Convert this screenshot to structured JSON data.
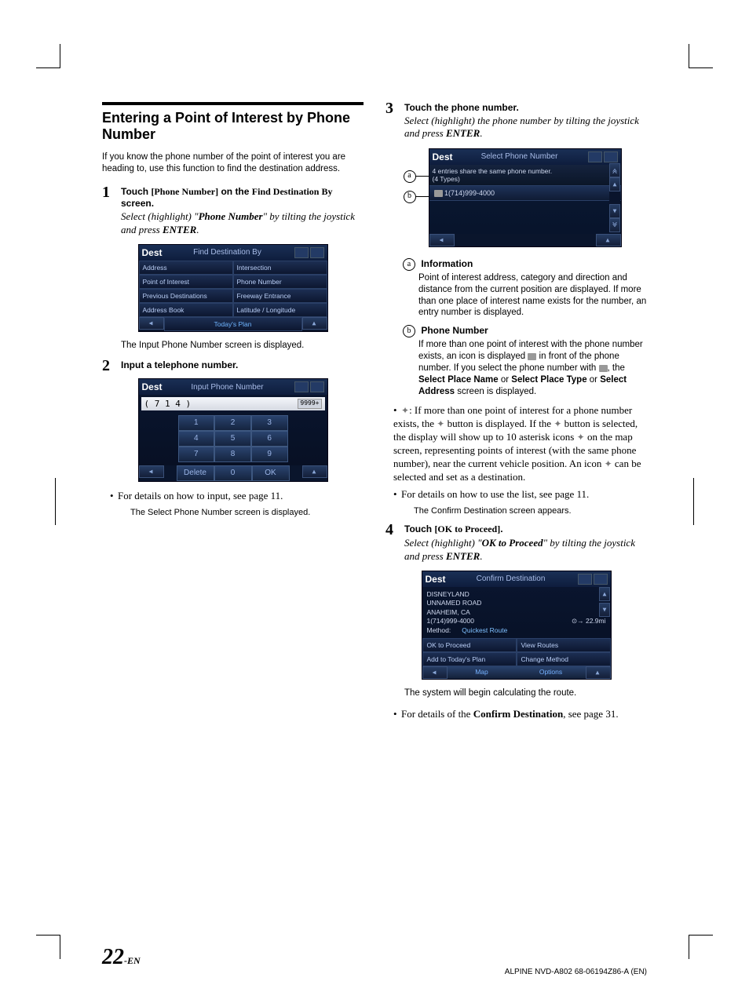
{
  "section": {
    "title": "Entering a Point of Interest by Phone Number",
    "intro": "If you know the phone number of the point of interest you are heading to, use this function to find the destination address."
  },
  "steps": {
    "s1": {
      "num": "1",
      "line1a": "Touch ",
      "line1b": "[Phone Number]",
      "line1c": " on the ",
      "line1d": "Find Destination By",
      "line1e": " screen.",
      "italic1": "Select (highlight) \"",
      "italic2": "Phone Number",
      "italic3": "\" by tilting the joystick and press ",
      "italic4": "ENTER",
      "italic5": ".",
      "after": "The Input Phone Number screen is displayed."
    },
    "s2": {
      "num": "2",
      "title": "Input a telephone number.",
      "bullet": "For details on how to input, see page 11.",
      "after": "The Select Phone Number screen is displayed."
    },
    "s3": {
      "num": "3",
      "title": "Touch the phone number.",
      "italic": "Select (highlight) the phone number by tilting the joystick and press ",
      "italic2": "ENTER",
      "italic3": "."
    },
    "s4": {
      "num": "4",
      "line1a": "Touch ",
      "line1b": "[OK to Proceed]",
      "line1c": ".",
      "italic1": "Select (highlight) \"",
      "italic2": "OK to Proceed",
      "italic3": "\" by tilting the joystick and press ",
      "italic4": "ENTER",
      "italic5": ".",
      "after": "The system will begin calculating the route.",
      "bullet1": "For details of the ",
      "bullet2": "Confirm Destination",
      "bullet3": ", see page 31."
    }
  },
  "callouts": {
    "a": {
      "letter": "a",
      "title": "Information",
      "body": "Point of interest address, category and direction and distance from the current position are displayed. If more than one place of interest name exists for the number, an entry number is displayed."
    },
    "b": {
      "letter": "b",
      "title": "Phone Number",
      "body1": "If more than one point of interest with the phone number exists, an icon is displayed ",
      "body2": " in front of the phone number. If you select the phone number with ",
      "body3": ", the ",
      "body4": "Select Place Name",
      "body5": " or ",
      "body6": "Select Place Type",
      "body7": " or ",
      "body8": "Select Address",
      "body9": " screen is displayed."
    }
  },
  "bullets": {
    "star1": ": If more than one point of interest for a phone number exists, the ",
    "star2": " button is displayed. If the ",
    "star3": " button is selected, the display will show up to 10 asterisk icons ",
    "star4": " on the map screen, representing points of interest (with the same phone number), near the current vehicle position. An icon ",
    "star5": " can be selected and set as a destination.",
    "list": "For details on how to use the list, see page 11.",
    "listAfter": "The Confirm Destination screen appears."
  },
  "screens": {
    "findDest": {
      "dest": "Dest",
      "title": "Find Destination By",
      "cells": [
        "Address",
        "Intersection",
        "Point of Interest",
        "Phone Number",
        "Previous Destinations",
        "Freeway Entrance",
        "Address Book",
        "Latitude / Longitude"
      ],
      "todays": "Today's Plan"
    },
    "inputPhone": {
      "dest": "Dest",
      "title": "Input Phone Number",
      "entry": "( 7 1 4 )",
      "entryR": "9999+",
      "keys": [
        "1",
        "2",
        "3",
        "4",
        "5",
        "6",
        "7",
        "8",
        "9",
        "Delete",
        "0",
        "OK"
      ]
    },
    "selectPhone": {
      "dest": "Dest",
      "title": "Select Phone Number",
      "info1": "4 entries share the same phone number.",
      "info2": "(4 Types)",
      "entry": "1(714)999-4000"
    },
    "confirm": {
      "dest": "Dest",
      "title": "Confirm Destination",
      "poi": "DISNEYLAND",
      "road": "UNNAMED ROAD",
      "city": "ANAHEIM, CA",
      "phone": "1(714)999-4000",
      "methodL": "Method:",
      "methodV": "Quickest Route",
      "dist": "22.9mi",
      "b1": "OK to Proceed",
      "b2": "View Routes",
      "b3": "Add to Today's Plan",
      "b4": "Change Method",
      "map": "Map",
      "opt": "Options"
    }
  },
  "page": {
    "num": "22",
    "suffix": "-EN"
  },
  "footer": "ALPINE NVD-A802 68-06194Z86-A (EN)"
}
